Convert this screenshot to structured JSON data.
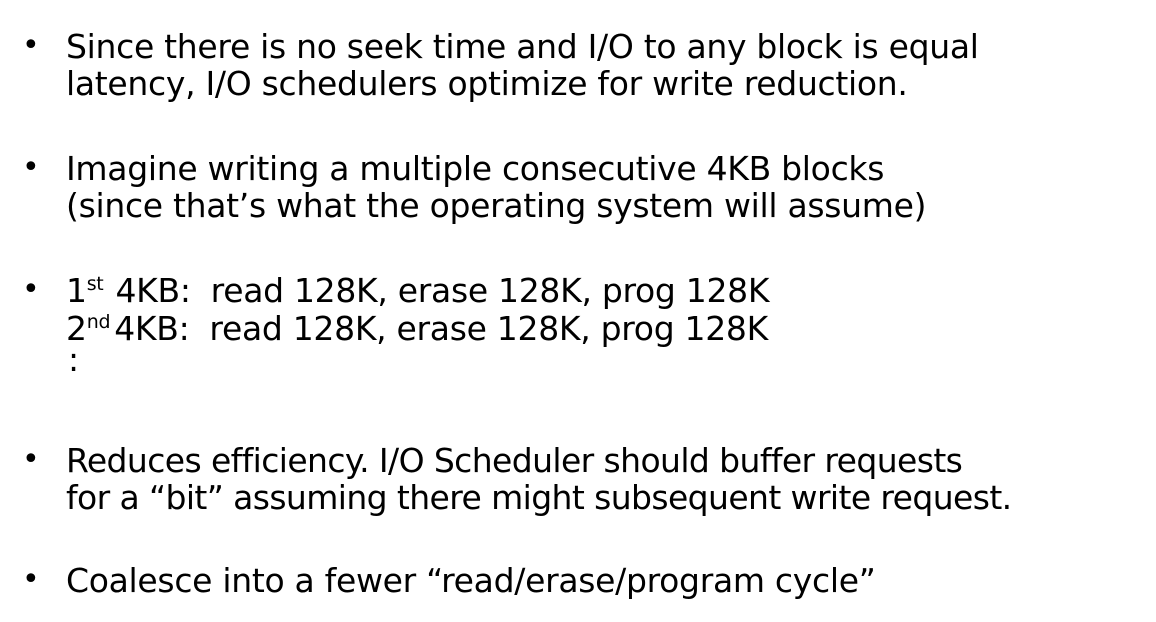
{
  "bullets": [
    {
      "lines": [
        "Since there is no seek time and I/O to any block is equal",
        "latency, I/O schedulers optimize for write reduction."
      ]
    },
    {
      "lines": [
        "Imagine writing a multiple consecutive 4KB blocks",
        "(since that’s what the operating system will assume)"
      ]
    },
    {
      "steps": [
        {
          "ordinal": "1",
          "suffix": "st",
          "block": "4KB:",
          "ops": "read 128K, erase 128K, prog 128K"
        },
        {
          "ordinal": "2",
          "suffix": "nd",
          "block": "4KB:",
          "ops": "read 128K, erase 128K, prog 128K"
        }
      ],
      "continuation": ":"
    },
    {
      "lines": [
        "Reduces efficiency. I/O Scheduler should buffer requests",
        "for a “bit” assuming there might subsequent write request."
      ]
    },
    {
      "lines": [
        "Coalesce into a fewer “read/erase/program cycle”"
      ]
    }
  ],
  "bullet_glyph": "•"
}
